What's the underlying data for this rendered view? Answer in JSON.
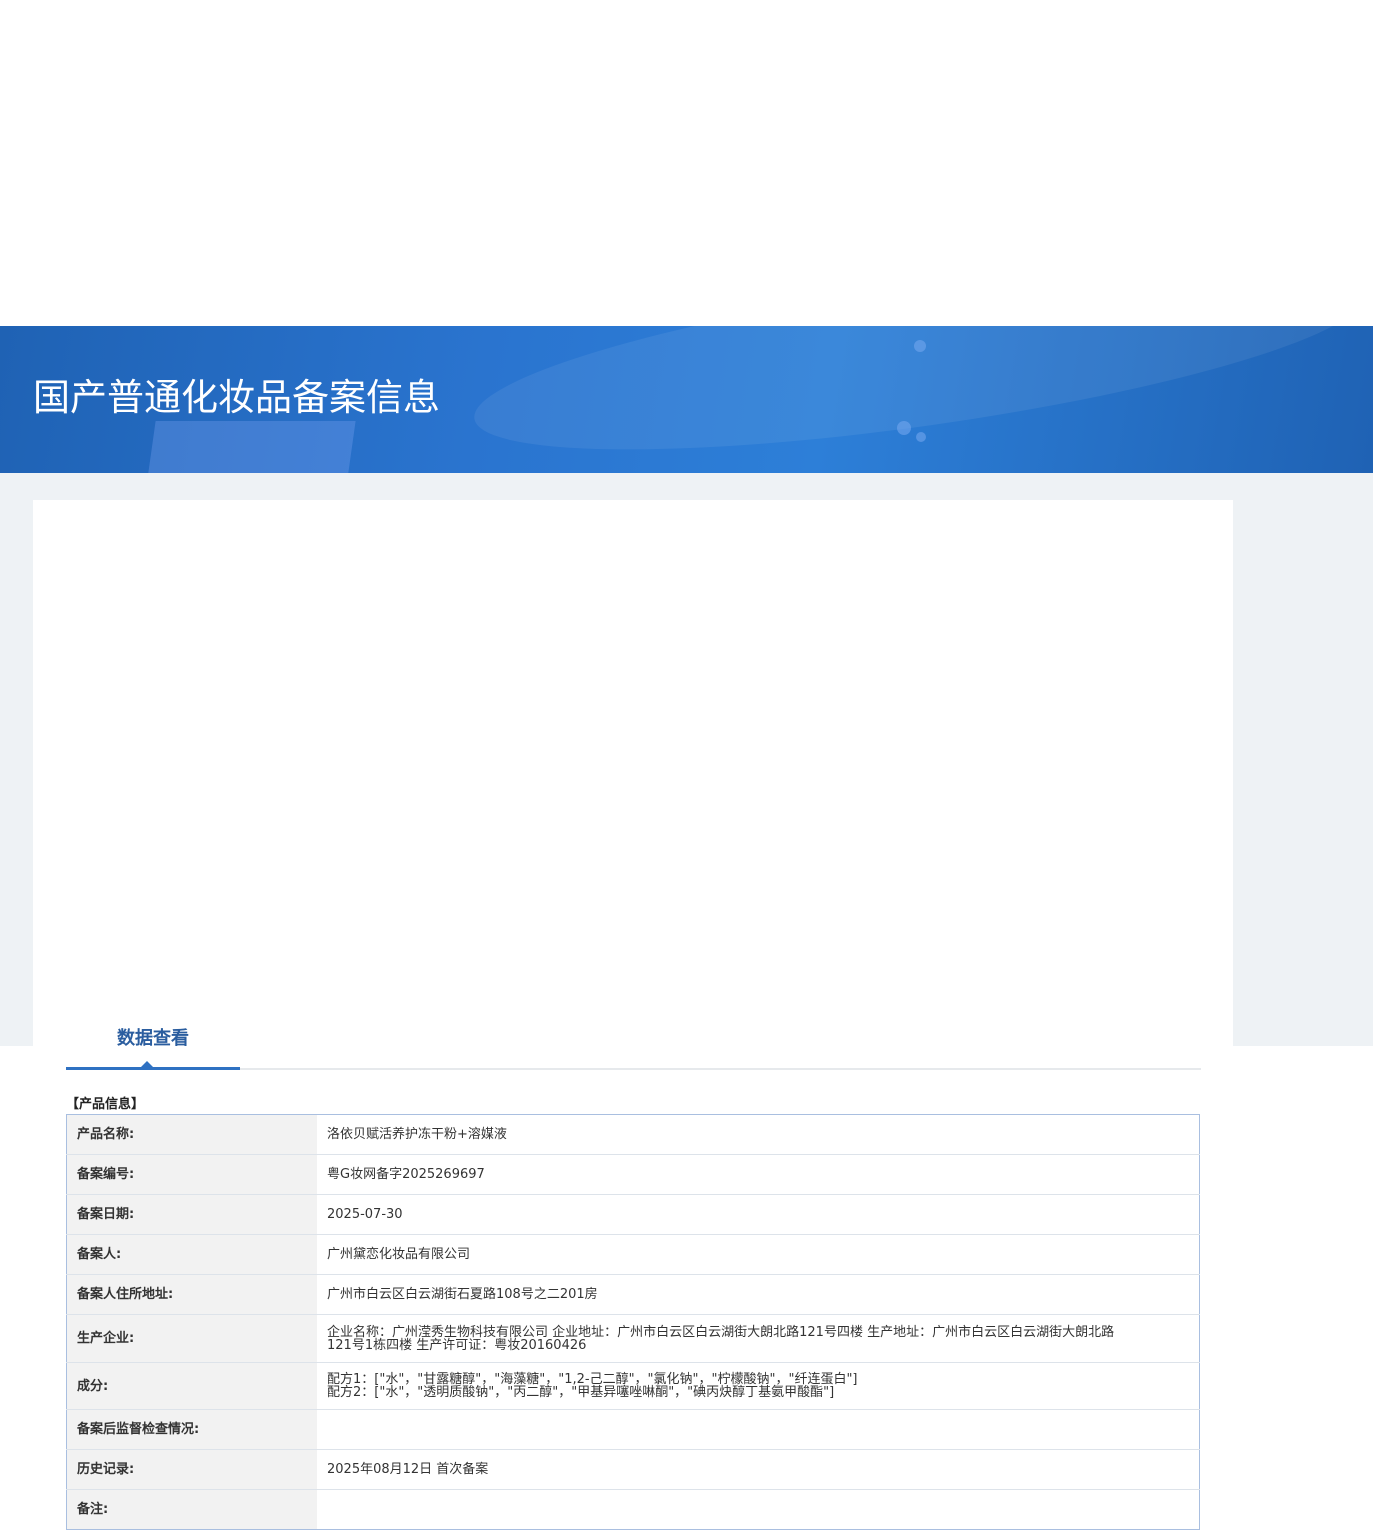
{
  "banner": {
    "title": "国产普通化妆品备案信息"
  },
  "tabs": [
    {
      "label": "数据查看"
    }
  ],
  "section": {
    "title": "【产品信息】"
  },
  "rows": [
    {
      "label": "产品名称:",
      "value": "洛依贝赋活养护冻干粉+溶媒液"
    },
    {
      "label": "备案编号:",
      "value": "粤G妆网备字2025269697"
    },
    {
      "label": "备案日期:",
      "value": "2025-07-30"
    },
    {
      "label": "备案人:",
      "value": "广州黛恋化妆品有限公司"
    },
    {
      "label": "备案人住所地址:",
      "value": "广州市白云区白云湖街石夏路108号之二201房"
    },
    {
      "label": "生产企业:",
      "lines": [
        "企业名称：广州滢秀生物科技有限公司 企业地址：广州市白云区白云湖街大朗北路121号四楼 生产地址：广州市白云区白云湖街大朗北路",
        "121号1栋四楼 生产许可证：粤妆20160426"
      ]
    },
    {
      "label": "成分:",
      "lines": [
        "配方1：[\"水\"，\"甘露糖醇\"，\"海藻糖\"，\"1,2-己二醇\"，\"氯化钠\"，\"柠檬酸钠\"，\"纤连蛋白\"]",
        "配方2：[\"水\"，\"透明质酸钠\"，\"丙二醇\"，\"甲基异噻唑啉酮\"，\"碘丙炔醇丁基氨甲酸酯\"]"
      ]
    },
    {
      "label": "备案后监督检查情况:",
      "value": ""
    },
    {
      "label": "历史记录:",
      "value": "2025年08月12日 首次备案"
    },
    {
      "label": "备注:",
      "value": ""
    }
  ]
}
